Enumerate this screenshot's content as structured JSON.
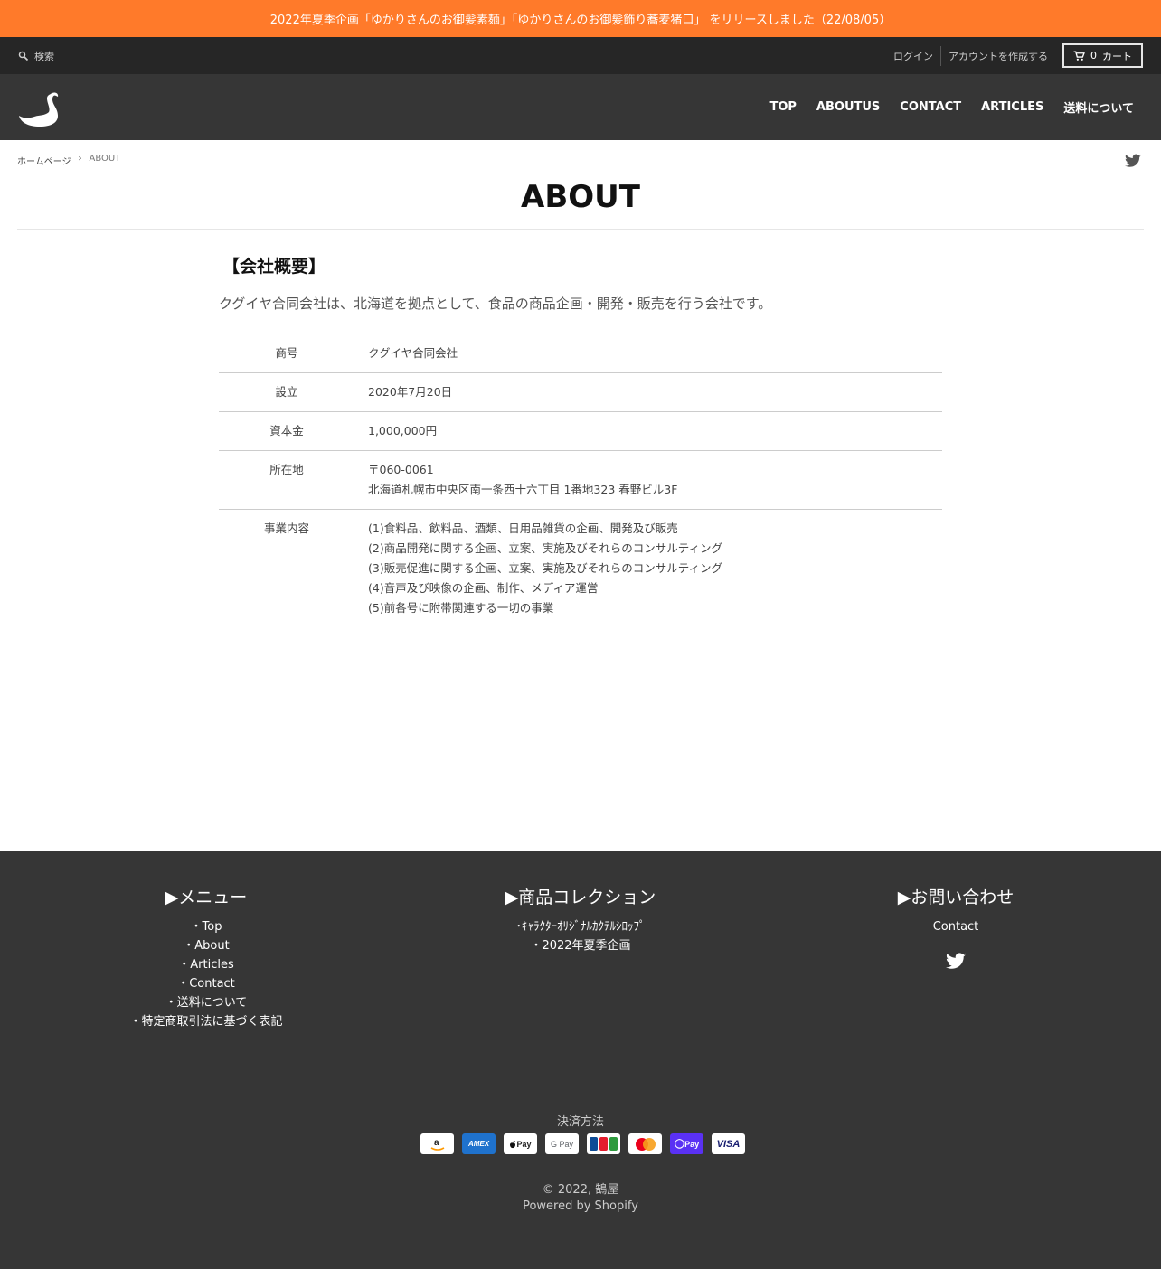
{
  "announcement": "2022年夏季企画「ゆかりさんのお御髪素麺」「ゆかりさんのお御髪飾り蕎麦猪口」 をリリースしました（22/08/05）",
  "utility": {
    "search_label": "検索",
    "login": "ログイン",
    "create_account": "アカウントを作成する",
    "cart_count": "0",
    "cart_label": "カート"
  },
  "nav": {
    "items": [
      "TOP",
      "ABOUTUS",
      "CONTACT",
      "ARTICLES",
      "送料について"
    ]
  },
  "breadcrumb": {
    "home": "ホームページ",
    "separator": "›",
    "current": "ABOUT"
  },
  "page": {
    "title": "ABOUT",
    "section_heading": "【会社概要】",
    "intro": "クグイヤ合同会社は、北海道を拠点として、食品の商品企画・開発・販売を行う会社です。"
  },
  "company": {
    "rows": [
      {
        "label": "商号",
        "lines": [
          "クグイヤ合同会社"
        ]
      },
      {
        "label": "設立",
        "lines": [
          "2020年7月20日"
        ]
      },
      {
        "label": "資本金",
        "lines": [
          "1,000,000円"
        ]
      },
      {
        "label": "所在地",
        "lines": [
          "〒060-0061",
          "北海道札幌市中央区南一条西十六丁目 1番地323 春野ビル3F"
        ]
      },
      {
        "label": "事業内容",
        "lines": [
          "(1)食料品、飲料品、酒類、日用品雑貨の企画、開発及び販売",
          "(2)商品開発に関する企画、立案、実施及びそれらのコンサルティング",
          "(3)販売促進に関する企画、立案、実施及びそれらのコンサルティング",
          "(4)音声及び映像の企画、制作、メディア運営",
          "(5)前各号に附帯関連する一切の事業"
        ]
      }
    ]
  },
  "footer": {
    "menu": {
      "title": "▶メニュー",
      "links": [
        "・Top",
        "・About",
        "・Articles",
        "・Contact",
        "・送料について",
        "・特定商取引法に基づく表記"
      ]
    },
    "collections": {
      "title": "▶商品コレクション",
      "links": [
        "･ｷｬﾗｸﾀｰｵﾘｼﾞﾅﾙｶｸﾃﾙｼﾛｯﾌﾟ",
        "・2022年夏季企画"
      ]
    },
    "contact": {
      "title": "▶お問い合わせ",
      "links": [
        "Contact"
      ]
    },
    "payment_title": "決済方法",
    "payment_icons": [
      "amazon-pay-icon",
      "amex-icon",
      "apple-pay-icon",
      "google-pay-icon",
      "jcb-icon",
      "mastercard-icon",
      "shop-pay-icon",
      "visa-icon"
    ],
    "payment_text": {
      "amex": "AMEX",
      "apple": "Pay",
      "google": "G Pay",
      "shop": "Pay",
      "visa": "VISA"
    },
    "copyright": "© 2022, 鵠屋",
    "powered": "Powered by Shopify"
  },
  "colors": {
    "announcement": "#ff7a2a",
    "utility_bar": "#262626",
    "header": "#363636",
    "footer": "#363636"
  }
}
